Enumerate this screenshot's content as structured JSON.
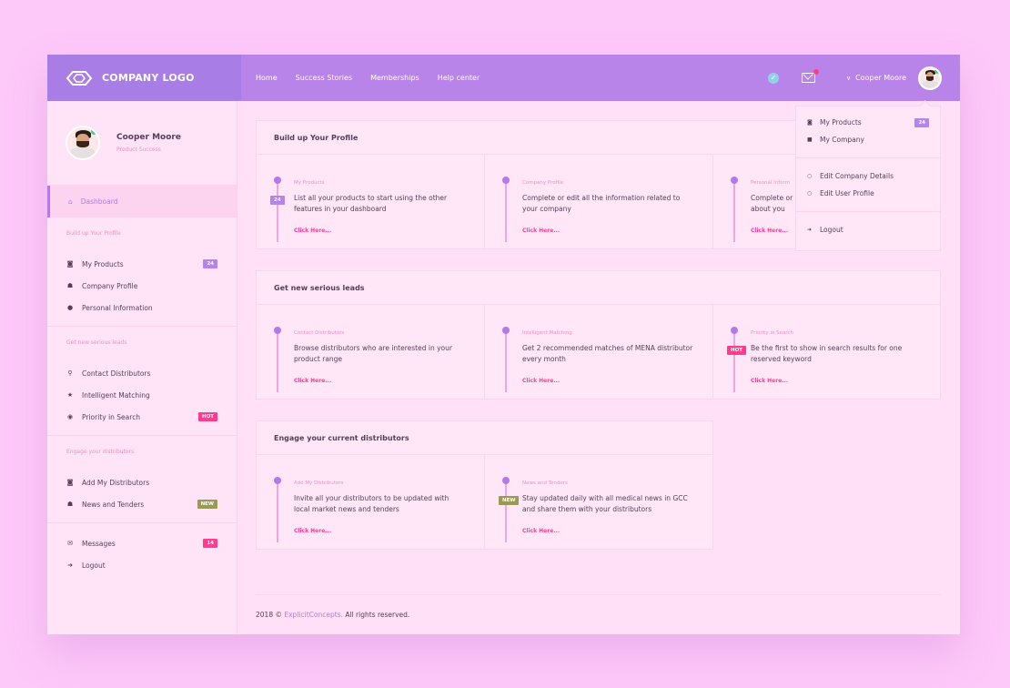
{
  "header": {
    "logo_text": "COMPANY LOGO",
    "nav": [
      "Home",
      "Success Stories",
      "Memberships",
      "Help center"
    ],
    "user_name": "Cooper Moore"
  },
  "profile": {
    "name": "Cooper Moore",
    "role": "Product Success"
  },
  "sidebar": {
    "active": "Dashboard",
    "sections": [
      {
        "title": "Build up Your Profile",
        "items": [
          {
            "label": "My Products",
            "icon": "camera-icon",
            "badge": "24",
            "badge_color": "purple"
          },
          {
            "label": "Company Profile",
            "icon": "users-icon"
          },
          {
            "label": "Personal Information",
            "icon": "user-icon"
          }
        ]
      },
      {
        "title": "Get new serious leads",
        "items": [
          {
            "label": "Contact Distributors",
            "icon": "search-icon"
          },
          {
            "label": "Intelligent Matching",
            "icon": "star-icon"
          },
          {
            "label": "Priority in Search",
            "icon": "target-icon",
            "badge": "HOT",
            "badge_color": "pink"
          }
        ]
      },
      {
        "title": "Engage your distributors",
        "items": [
          {
            "label": "Add My Distributors",
            "icon": "camera-icon"
          },
          {
            "label": "News and Tenders",
            "icon": "users-icon",
            "badge": "NEW",
            "badge_color": "olive"
          }
        ]
      },
      {
        "title": "",
        "items": [
          {
            "label": "Messages",
            "icon": "mail-icon",
            "badge": "14",
            "badge_color": "pink"
          },
          {
            "label": "Logout",
            "icon": "logout-icon"
          }
        ]
      }
    ]
  },
  "cards": [
    {
      "title": "Build up Your Profile",
      "steps": [
        {
          "kicker": "My Products",
          "desc": "List all your products to start using the other features in your dashboard",
          "link": "Click Here...",
          "badge": "24",
          "badge_color": "purple"
        },
        {
          "kicker": "Company Profile",
          "desc": "Complete or edit all the information related to your company",
          "link": "Click Here..."
        },
        {
          "kicker": "Personal Inform",
          "desc": "Complete or about you",
          "link": "Click Here..."
        }
      ]
    },
    {
      "title": "Get new serious leads",
      "steps": [
        {
          "kicker": "Contact Distributors",
          "desc": "Browse distributors who are interested in your product range",
          "link": "Click Here..."
        },
        {
          "kicker": "Intelligent Matching",
          "desc": "Get 2 recommended matches of MENA distributor every month",
          "link": "Click Here..."
        },
        {
          "kicker": "Priority in Search",
          "desc": "Be the first to show in search results for one reserved keyword",
          "link": "Click Here...",
          "badge": "HOT",
          "badge_color": "pink"
        }
      ]
    },
    {
      "title": "Engage your current distributors",
      "steps": [
        {
          "kicker": "Add My Distributors",
          "desc": "Invite all your distributors to be updated with local market news and tenders",
          "link": "Click Here..."
        },
        {
          "kicker": "News and Tenders",
          "desc": "Stay updated daily with all medical news in GCC and share them with your distributors",
          "link": "Click Here...",
          "badge": "NEW",
          "badge_color": "olive"
        }
      ]
    }
  ],
  "dropdown": {
    "items": [
      {
        "label": "My Products",
        "icon": "camera-icon",
        "badge": "24"
      },
      {
        "label": "My Company",
        "icon": "building-icon"
      },
      {
        "label": "Edit Company Details",
        "icon": "circle-icon"
      },
      {
        "label": "Edit User Profile",
        "icon": "circle-icon"
      },
      {
        "label": "Logout",
        "icon": "logout-icon"
      }
    ]
  },
  "footer": {
    "prefix": "2018 ©",
    "brand": "ExplicitConcepts.",
    "suffix": "All rights reserved."
  },
  "colors": {
    "topbar": "#b984ea",
    "accent": "#b27ae8",
    "pink": "#ff3d8f",
    "background": "#fdc9f9"
  }
}
